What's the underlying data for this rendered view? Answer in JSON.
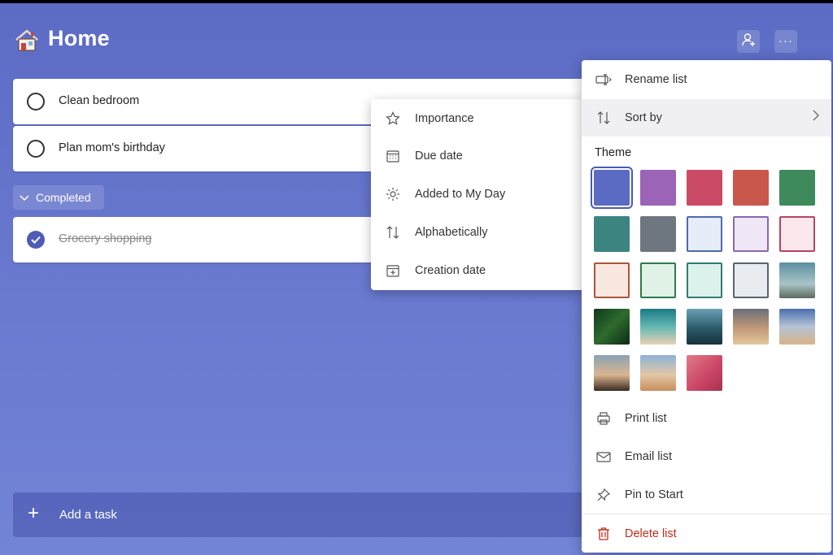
{
  "header": {
    "title": "Home",
    "icon": "house-icon",
    "share_icon": "person-add-icon",
    "more_icon": "ellipsis-icon"
  },
  "tasks": [
    {
      "label": "Clean bedroom",
      "completed": false
    },
    {
      "label": "Plan mom's birthday",
      "completed": false
    }
  ],
  "completed_section": {
    "label": "Completed",
    "tasks": [
      {
        "label": "Grocery shopping",
        "completed": true
      }
    ]
  },
  "add_task": {
    "label": "Add a task"
  },
  "sort_menu": {
    "items": [
      {
        "label": "Importance",
        "icon": "star-icon"
      },
      {
        "label": "Due date",
        "icon": "calendar-icon"
      },
      {
        "label": "Added to My Day",
        "icon": "sun-icon"
      },
      {
        "label": "Alphabetically",
        "icon": "sort-arrows-icon"
      },
      {
        "label": "Creation date",
        "icon": "calendar-add-icon"
      }
    ]
  },
  "list_menu": {
    "rename": {
      "label": "Rename list",
      "icon": "rename-icon"
    },
    "sort_by": {
      "label": "Sort by",
      "icon": "sort-arrows-icon"
    },
    "theme_label": "Theme",
    "themes": [
      {
        "name": "blue",
        "color": "#5b6ac2",
        "selected": true
      },
      {
        "name": "purple",
        "color": "#9b64b6"
      },
      {
        "name": "pink",
        "color": "#cb4b66"
      },
      {
        "name": "red",
        "color": "#c9574b"
      },
      {
        "name": "green",
        "color": "#3f8a5c"
      },
      {
        "name": "teal",
        "color": "#3b8480"
      },
      {
        "name": "gray",
        "color": "#6e7680"
      },
      {
        "name": "light-blue",
        "color": "#e6edf8",
        "border": "#4c6ab0"
      },
      {
        "name": "light-purple",
        "color": "#efe7f6",
        "border": "#8b65b4"
      },
      {
        "name": "light-pink",
        "color": "#fbe8ec",
        "border": "#b64463"
      },
      {
        "name": "light-peach",
        "color": "#f9e8df",
        "border": "#a9563c"
      },
      {
        "name": "light-green",
        "color": "#e1f2e6",
        "border": "#2e7b4c"
      },
      {
        "name": "light-teal",
        "color": "#ddf1ec",
        "border": "#2e7e70"
      },
      {
        "name": "light-gray",
        "color": "#e8ebef",
        "border": "#5a6370"
      },
      {
        "name": "photo-lighthouse-sky",
        "color": "linear-gradient(180deg,#5d8ea0 0%,#a9c4c8 60%,#5b6a5e 100%)"
      },
      {
        "name": "photo-fern",
        "color": "linear-gradient(135deg,#0f3a1c 0%,#2e6b2e 50%,#0d2a14 100%)"
      },
      {
        "name": "photo-beach-aerial",
        "color": "linear-gradient(180deg,#1c7a86 0%,#63b7b2 50%,#e8d1b7 100%)"
      },
      {
        "name": "photo-mountain-lake",
        "color": "linear-gradient(180deg,#6aa1b4 0%,#2a5a6a 55%,#18323c 100%)"
      },
      {
        "name": "photo-sunset-shore",
        "color": "linear-gradient(180deg,#6b6f7a 0%,#c29a78 55%,#e3c69c 100%)"
      },
      {
        "name": "photo-desert-sky",
        "color": "linear-gradient(180deg,#4a6fb0 0%,#b5c3d6 50%,#d7b486 100%)"
      },
      {
        "name": "photo-lighthouse-dusk",
        "color": "linear-gradient(180deg,#8aa3b6 0%,#d9b590 55%,#3b2c22 100%)"
      },
      {
        "name": "photo-balloon-field",
        "color": "linear-gradient(180deg,#8bb4d8 0%,#e3c7a6 55%,#c78e5c 100%)"
      },
      {
        "name": "photo-pink-abstract",
        "color": "linear-gradient(135deg,#e07a86 0%,#c94464 60%,#a83350 100%)"
      }
    ],
    "print": {
      "label": "Print list",
      "icon": "printer-icon"
    },
    "email": {
      "label": "Email list",
      "icon": "mail-icon"
    },
    "pin": {
      "label": "Pin to Start",
      "icon": "pin-icon"
    },
    "delete": {
      "label": "Delete list",
      "icon": "trash-icon"
    }
  }
}
